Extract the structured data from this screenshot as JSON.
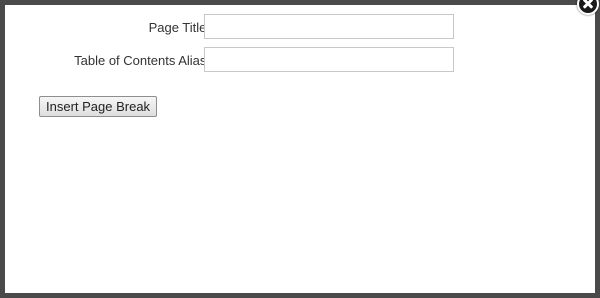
{
  "dialog": {
    "close_icon": "close-icon",
    "fields": {
      "page_title": {
        "label": "Page Title:",
        "value": "",
        "placeholder": ""
      },
      "toc_alias": {
        "label": "Table of Contents Alias:",
        "value": "",
        "placeholder": ""
      }
    },
    "insert_button_label": "Insert Page Break"
  }
}
